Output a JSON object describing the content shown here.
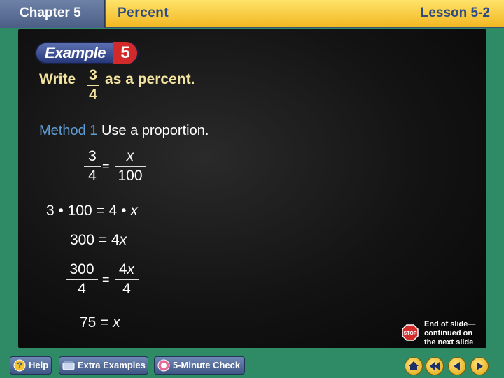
{
  "header": {
    "chapter_label": "Chapter 5",
    "section_title": "Percent",
    "lesson_label": "Lesson 5-2"
  },
  "example": {
    "word": "Example",
    "number": "5"
  },
  "problem": {
    "prefix": "Write",
    "numerator": "3",
    "denominator": "4",
    "suffix": "as a percent."
  },
  "method": {
    "label": "Method 1",
    "text": "Use a proportion."
  },
  "steps": {
    "s1_lhs_num": "3",
    "s1_lhs_den": "4",
    "s1_eq": "=",
    "s1_rhs_num": "x",
    "s1_rhs_den": "100",
    "s2": "3 • 100 = 4 • x",
    "s3": "300 = 4x",
    "s4_lhs_num": "300",
    "s4_lhs_den": "4",
    "s4_eq": "=",
    "s4_rhs_num": "4x",
    "s4_rhs_den": "4",
    "s5": "75 = x"
  },
  "end_of_slide": {
    "line1": "End of slide—",
    "line2": "continued on",
    "line3": "the next slide",
    "icon": "stop-icon"
  },
  "footer": {
    "help_label": "Help",
    "extra_label": "Extra Examples",
    "check_label": "5-Minute Check"
  },
  "colors": {
    "background": "#2f8a66",
    "title_band": "#f2b824",
    "board": "#131313",
    "accent_text": "#f3e3a0",
    "method_blue": "#5e9ed6"
  }
}
